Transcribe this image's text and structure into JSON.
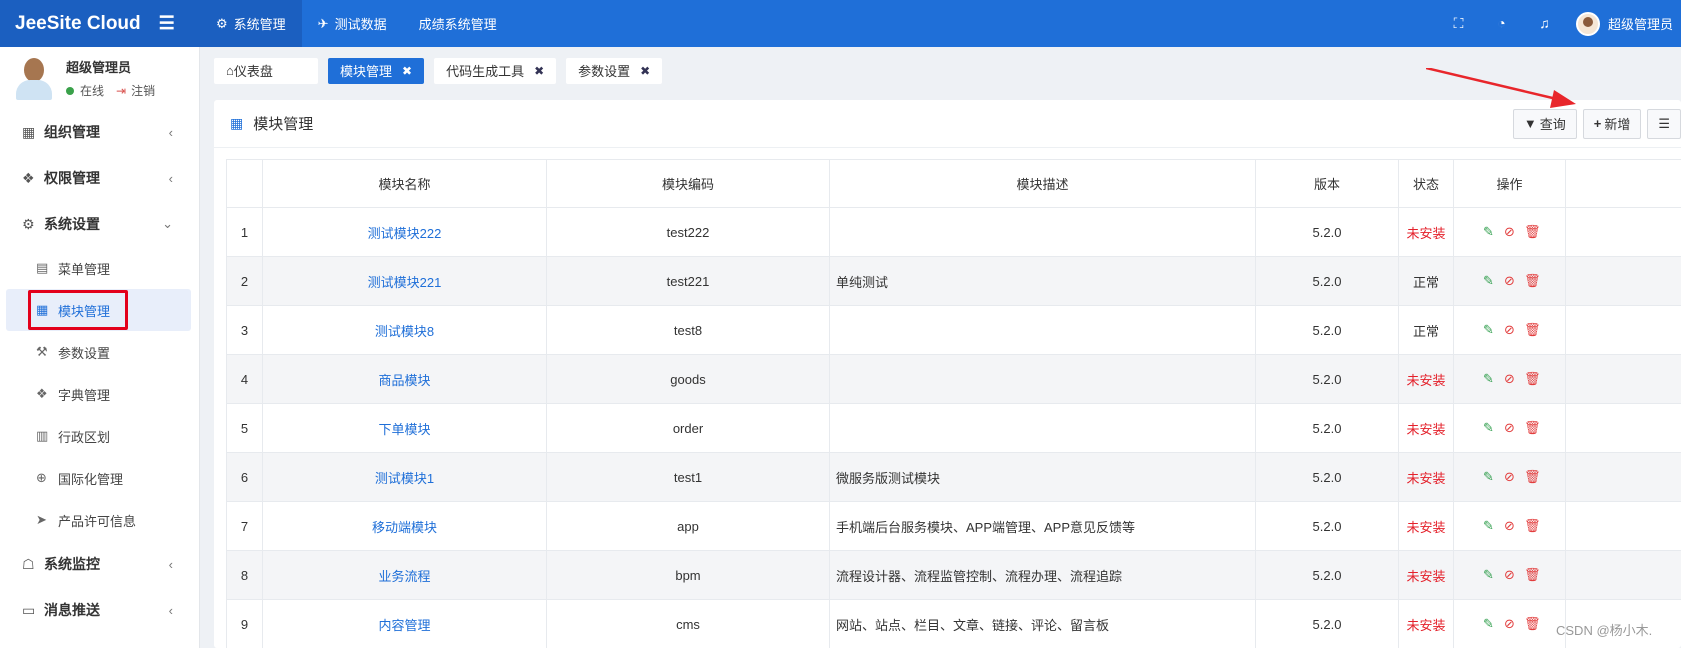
{
  "topbar": {
    "brand": "JeeSite Cloud",
    "nav": [
      {
        "icon": "gear-icon",
        "glyph": "⚙",
        "label": "系统管理",
        "active": true
      },
      {
        "icon": "rocket-icon",
        "glyph": "✈",
        "label": "测试数据",
        "active": false
      },
      {
        "icon": "",
        "glyph": "",
        "label": "成绩系统管理",
        "active": false
      }
    ],
    "tools": [
      {
        "icon": "fullscreen-icon",
        "glyph": "⛶"
      },
      {
        "icon": "dashboard-icon",
        "glyph": "◔"
      },
      {
        "icon": "bell-icon",
        "glyph": "♫"
      }
    ],
    "user_label": "超级管理员"
  },
  "sidebar": {
    "user": {
      "name": "超级管理员",
      "status": "在线",
      "logout": "注销"
    },
    "menu": [
      {
        "type": "grp",
        "name": "org",
        "icon": "grid-icon",
        "glyph": "▦",
        "label": "组织管理",
        "arrow": "‹"
      },
      {
        "type": "grp",
        "name": "perm",
        "icon": "cube-icon",
        "glyph": "❖",
        "label": "权限管理",
        "arrow": "‹"
      },
      {
        "type": "grp",
        "name": "sys",
        "icon": "gear-icon",
        "glyph": "⚙",
        "label": "系统设置",
        "arrow": "⌄"
      },
      {
        "type": "sub",
        "name": "menu-mgmt",
        "icon": "book-icon",
        "glyph": "▤",
        "label": "菜单管理"
      },
      {
        "type": "sub",
        "name": "module-mgmt",
        "icon": "grid-icon",
        "glyph": "▦",
        "label": "模块管理",
        "active": true
      },
      {
        "type": "sub",
        "name": "params",
        "icon": "wrench-icon",
        "glyph": "⚒",
        "label": "参数设置"
      },
      {
        "type": "sub",
        "name": "dict",
        "icon": "cube-icon",
        "glyph": "❖",
        "label": "字典管理"
      },
      {
        "type": "sub",
        "name": "region",
        "icon": "map-icon",
        "glyph": "▥",
        "label": "行政区划"
      },
      {
        "type": "sub",
        "name": "i18n",
        "icon": "globe-icon",
        "glyph": "⊕",
        "label": "国际化管理"
      },
      {
        "type": "sub",
        "name": "license",
        "icon": "send-icon",
        "glyph": "➤",
        "label": "产品许可信息"
      },
      {
        "type": "grp",
        "name": "monitor",
        "icon": "ghost-icon",
        "glyph": "☖",
        "label": "系统监控",
        "arrow": "‹"
      },
      {
        "type": "grp",
        "name": "msg",
        "icon": "message-icon",
        "glyph": "▭",
        "label": "消息推送",
        "arrow": "‹"
      }
    ]
  },
  "tabs": [
    {
      "label": "仪表盘",
      "icon": "home-icon",
      "glyph": "⌂",
      "closable": false,
      "active": false
    },
    {
      "label": "模块管理",
      "closable": true,
      "active": true
    },
    {
      "label": "代码生成工具",
      "closable": true,
      "active": false
    },
    {
      "label": "参数设置",
      "closable": true,
      "active": false
    }
  ],
  "panel": {
    "title": "模块管理",
    "query_label": "查询",
    "add_label": "新增"
  },
  "table": {
    "headers": [
      "",
      "模块名称",
      "模块编码",
      "模块描述",
      "版本",
      "状态",
      "操作"
    ],
    "rows": [
      {
        "no": "1",
        "name": "测试模块222",
        "code": "test222",
        "desc": "",
        "version": "5.2.0",
        "status": "未安装",
        "bad": true
      },
      {
        "no": "2",
        "name": "测试模块221",
        "code": "test221",
        "desc": "单纯测试",
        "version": "5.2.0",
        "status": "正常",
        "bad": false
      },
      {
        "no": "3",
        "name": "测试模块8",
        "code": "test8",
        "desc": "",
        "version": "5.2.0",
        "status": "正常",
        "bad": false
      },
      {
        "no": "4",
        "name": "商品模块",
        "code": "goods",
        "desc": "",
        "version": "5.2.0",
        "status": "未安装",
        "bad": true
      },
      {
        "no": "5",
        "name": "下单模块",
        "code": "order",
        "desc": "",
        "version": "5.2.0",
        "status": "未安装",
        "bad": true
      },
      {
        "no": "6",
        "name": "测试模块1",
        "code": "test1",
        "desc": "微服务版测试模块",
        "version": "5.2.0",
        "status": "未安装",
        "bad": true
      },
      {
        "no": "7",
        "name": "移动端模块",
        "code": "app",
        "desc": "手机端后台服务模块、APP端管理、APP意见反馈等",
        "version": "5.2.0",
        "status": "未安装",
        "bad": true
      },
      {
        "no": "8",
        "name": "业务流程",
        "code": "bpm",
        "desc": "流程设计器、流程监管控制、流程办理、流程追踪",
        "version": "5.2.0",
        "status": "未安装",
        "bad": true
      },
      {
        "no": "9",
        "name": "内容管理",
        "code": "cms",
        "desc": "网站、站点、栏目、文章、链接、评论、留言板",
        "version": "5.2.0",
        "status": "未安装",
        "bad": true
      }
    ]
  },
  "watermark": "CSDN @杨小木."
}
